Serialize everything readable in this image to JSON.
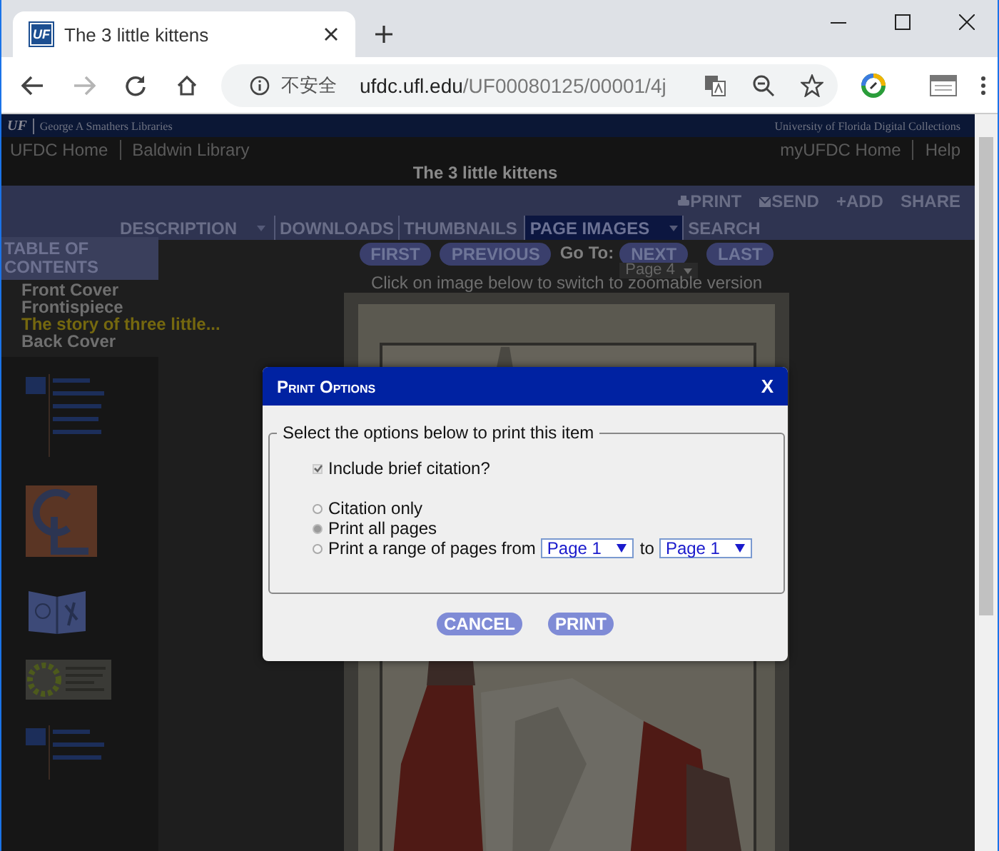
{
  "browser": {
    "tab": {
      "favicon": "UF",
      "title": "The 3 little kittens"
    },
    "forward_disabled": true,
    "security_label": "不安全",
    "url_host": "ufdc.ufl.edu",
    "url_path": "/UF00080125/00001/4j"
  },
  "header": {
    "logo": "UF",
    "library": "George A Smathers Libraries",
    "collection": "University of Florida Digital Collections"
  },
  "breadcrumbs": [
    "UFDC Home",
    "Baldwin Library"
  ],
  "user_links": [
    "myUFDC Home",
    "Help"
  ],
  "title": "The 3 little kittens",
  "actions": [
    {
      "kind": "print",
      "label": "PRINT"
    },
    {
      "kind": "send",
      "label": "SEND"
    },
    {
      "kind": "plain",
      "label": "+ADD"
    },
    {
      "kind": "plain",
      "label": "SHARE"
    }
  ],
  "tabs": [
    {
      "label": "DESCRIPTION",
      "selected": false,
      "dropdown": true
    },
    {
      "label": "DOWNLOADS",
      "selected": false,
      "dropdown": false
    },
    {
      "label": "THUMBNAILS",
      "selected": false,
      "dropdown": false
    },
    {
      "label": "PAGE IMAGES",
      "selected": true,
      "dropdown": true
    },
    {
      "label": "SEARCH",
      "selected": false,
      "dropdown": false
    }
  ],
  "toc": {
    "heading": "TABLE OF CONTENTS",
    "items": [
      {
        "label": "Front Cover",
        "selected": false
      },
      {
        "label": "Frontispiece",
        "selected": false
      },
      {
        "label": "The story of three little...",
        "selected": true
      },
      {
        "label": "Back Cover",
        "selected": false
      }
    ]
  },
  "pager": {
    "first": "FIRST",
    "previous": "PREVIOUS",
    "goto_label": "Go To:",
    "next": "NEXT",
    "last": "LAST",
    "page_select": "Page 4",
    "hint": "Click on image below to switch to zoomable version"
  },
  "dialog": {
    "title": "Print Options",
    "close": "X",
    "legend": "Select the options below to print this item",
    "citation": {
      "label": "Include brief citation?",
      "checked": true
    },
    "options": [
      {
        "kind": "plain",
        "label": "Citation only",
        "selected": false
      },
      {
        "kind": "plain",
        "label": "Print all pages",
        "selected": true
      },
      {
        "kind": "range",
        "label": "Print a range of pages from",
        "from": "Page 1",
        "joiner": "to",
        "to": "Page 1",
        "selected": false
      }
    ],
    "buttons": [
      "CANCEL",
      "PRINT"
    ]
  }
}
